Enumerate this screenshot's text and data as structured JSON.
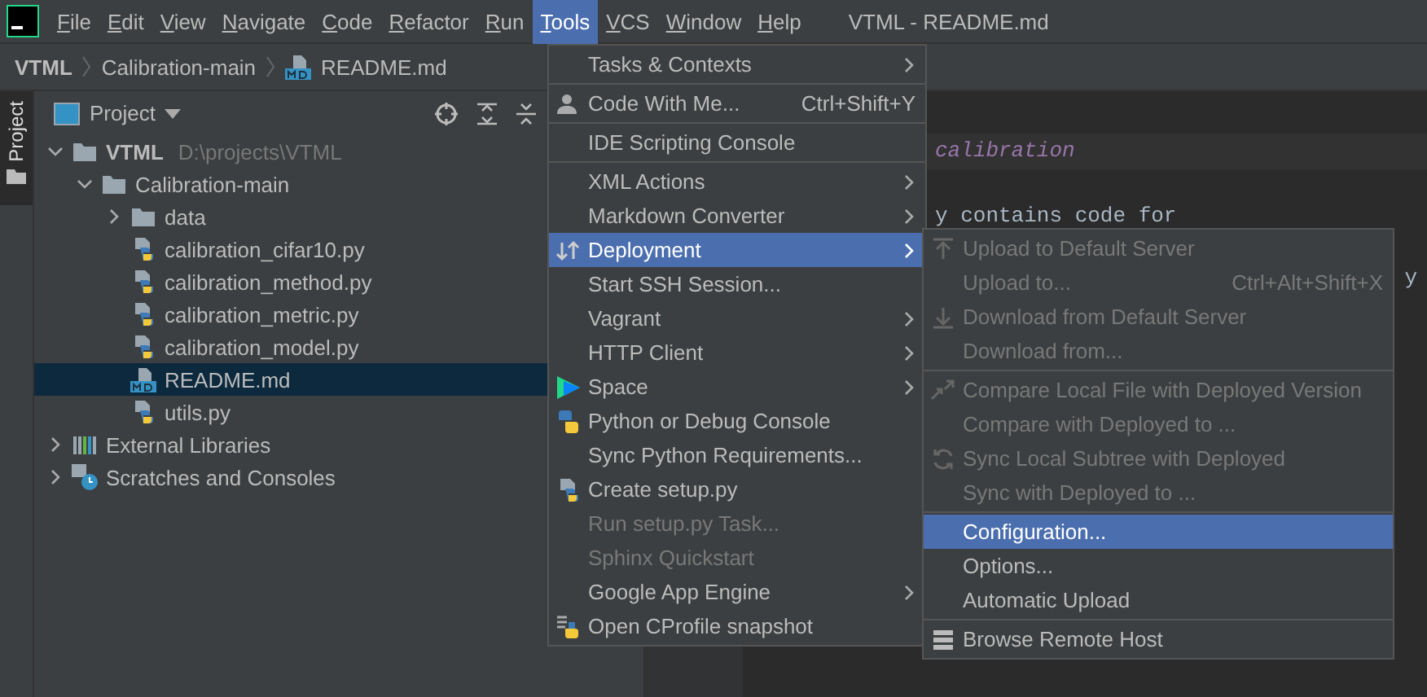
{
  "window": {
    "title": "VTML - README.md"
  },
  "menubar": [
    {
      "label": "File",
      "selected": false
    },
    {
      "label": "Edit",
      "selected": false
    },
    {
      "label": "View",
      "selected": false
    },
    {
      "label": "Navigate",
      "selected": false
    },
    {
      "label": "Code",
      "selected": false
    },
    {
      "label": "Refactor",
      "selected": false
    },
    {
      "label": "Run",
      "selected": false
    },
    {
      "label": "Tools",
      "selected": true
    },
    {
      "label": "VCS",
      "selected": false
    },
    {
      "label": "Window",
      "selected": false
    },
    {
      "label": "Help",
      "selected": false
    }
  ],
  "breadcrumb": [
    {
      "label": "VTML",
      "kind": "project"
    },
    {
      "label": "Calibration-main",
      "kind": "folder"
    },
    {
      "label": "README.md",
      "kind": "markdown"
    }
  ],
  "side_tab": {
    "label": "Project"
  },
  "project_panel": {
    "title": "Project",
    "tree": [
      {
        "label": "VTML",
        "path": "D:\\projects\\VTML",
        "kind": "folder",
        "expanded": true,
        "selected": false,
        "children": [
          {
            "label": "Calibration-main",
            "kind": "folder",
            "expanded": true,
            "selected": false,
            "children": [
              {
                "label": "data",
                "kind": "folder",
                "expanded": false,
                "selected": false
              },
              {
                "label": "calibration_cifar10.py",
                "kind": "python",
                "selected": false
              },
              {
                "label": "calibration_method.py",
                "kind": "python",
                "selected": false
              },
              {
                "label": "calibration_metric.py",
                "kind": "python",
                "selected": false
              },
              {
                "label": "calibration_model.py",
                "kind": "python",
                "selected": false
              },
              {
                "label": "README.md",
                "kind": "markdown",
                "selected": true
              },
              {
                "label": "utils.py",
                "kind": "python",
                "selected": false
              }
            ]
          }
        ]
      },
      {
        "label": "External Libraries",
        "kind": "libraries",
        "expanded": false,
        "selected": false
      },
      {
        "label": "Scratches and Consoles",
        "kind": "scratches",
        "expanded": false,
        "selected": false
      }
    ]
  },
  "editor": {
    "lines": [
      {
        "text": "calibration",
        "kind": "heading"
      },
      {
        "kind": "blank"
      },
      {
        "text": "y contains code for",
        "kind": "text"
      },
      {
        "kind": "blank"
      },
      {
        "text": "y",
        "kind": "edge"
      }
    ]
  },
  "tools_menu": {
    "sections": [
      [
        {
          "label": "Tasks & Contexts",
          "submenu": true,
          "disabled": false,
          "selected": false
        }
      ],
      [
        {
          "label": "Code With Me...",
          "shortcut": "Ctrl+Shift+Y",
          "submenu": false,
          "disabled": false,
          "selected": false
        }
      ],
      [
        {
          "label": "IDE Scripting Console",
          "submenu": false,
          "disabled": false,
          "selected": false
        }
      ],
      [
        {
          "label": "XML Actions",
          "submenu": true,
          "disabled": false,
          "selected": false
        },
        {
          "label": "Markdown Converter",
          "submenu": true,
          "disabled": false,
          "selected": false
        },
        {
          "label": "Deployment",
          "submenu": true,
          "disabled": false,
          "selected": true
        },
        {
          "label": "Start SSH Session...",
          "submenu": false,
          "disabled": false,
          "selected": false
        },
        {
          "label": "Vagrant",
          "submenu": true,
          "disabled": false,
          "selected": false
        },
        {
          "label": "HTTP Client",
          "submenu": true,
          "disabled": false,
          "selected": false
        },
        {
          "label": "Space",
          "submenu": true,
          "disabled": false,
          "selected": false
        },
        {
          "label": "Python or Debug Console",
          "submenu": false,
          "disabled": false,
          "selected": false
        },
        {
          "label": "Sync Python Requirements...",
          "submenu": false,
          "disabled": false,
          "selected": false
        },
        {
          "label": "Create setup.py",
          "submenu": false,
          "disabled": false,
          "selected": false
        },
        {
          "label": "Run setup.py Task...",
          "submenu": false,
          "disabled": true,
          "selected": false
        },
        {
          "label": "Sphinx Quickstart",
          "submenu": false,
          "disabled": true,
          "selected": false
        },
        {
          "label": "Google App Engine",
          "submenu": true,
          "disabled": false,
          "selected": false
        },
        {
          "label": "Open CProfile snapshot",
          "submenu": false,
          "disabled": false,
          "selected": false
        }
      ]
    ]
  },
  "deployment_menu": {
    "sections": [
      [
        {
          "label": "Upload to Default Server",
          "disabled": true,
          "selected": false
        },
        {
          "label": "Upload to...",
          "shortcut": "Ctrl+Alt+Shift+X",
          "disabled": true,
          "selected": false
        },
        {
          "label": "Download from Default Server",
          "disabled": true,
          "selected": false
        },
        {
          "label": "Download from...",
          "disabled": true,
          "selected": false
        }
      ],
      [
        {
          "label": "Compare Local File with Deployed Version",
          "disabled": true,
          "selected": false
        },
        {
          "label": "Compare with Deployed to ...",
          "disabled": true,
          "selected": false
        },
        {
          "label": "Sync Local Subtree with Deployed",
          "disabled": true,
          "selected": false
        },
        {
          "label": "Sync with Deployed to ...",
          "disabled": true,
          "selected": false
        }
      ],
      [
        {
          "label": "Configuration...",
          "disabled": false,
          "selected": true
        },
        {
          "label": "Options...",
          "disabled": false,
          "selected": false
        },
        {
          "label": "Automatic Upload",
          "disabled": false,
          "selected": false
        }
      ],
      [
        {
          "label": "Browse Remote Host",
          "disabled": false,
          "selected": false
        }
      ]
    ]
  }
}
